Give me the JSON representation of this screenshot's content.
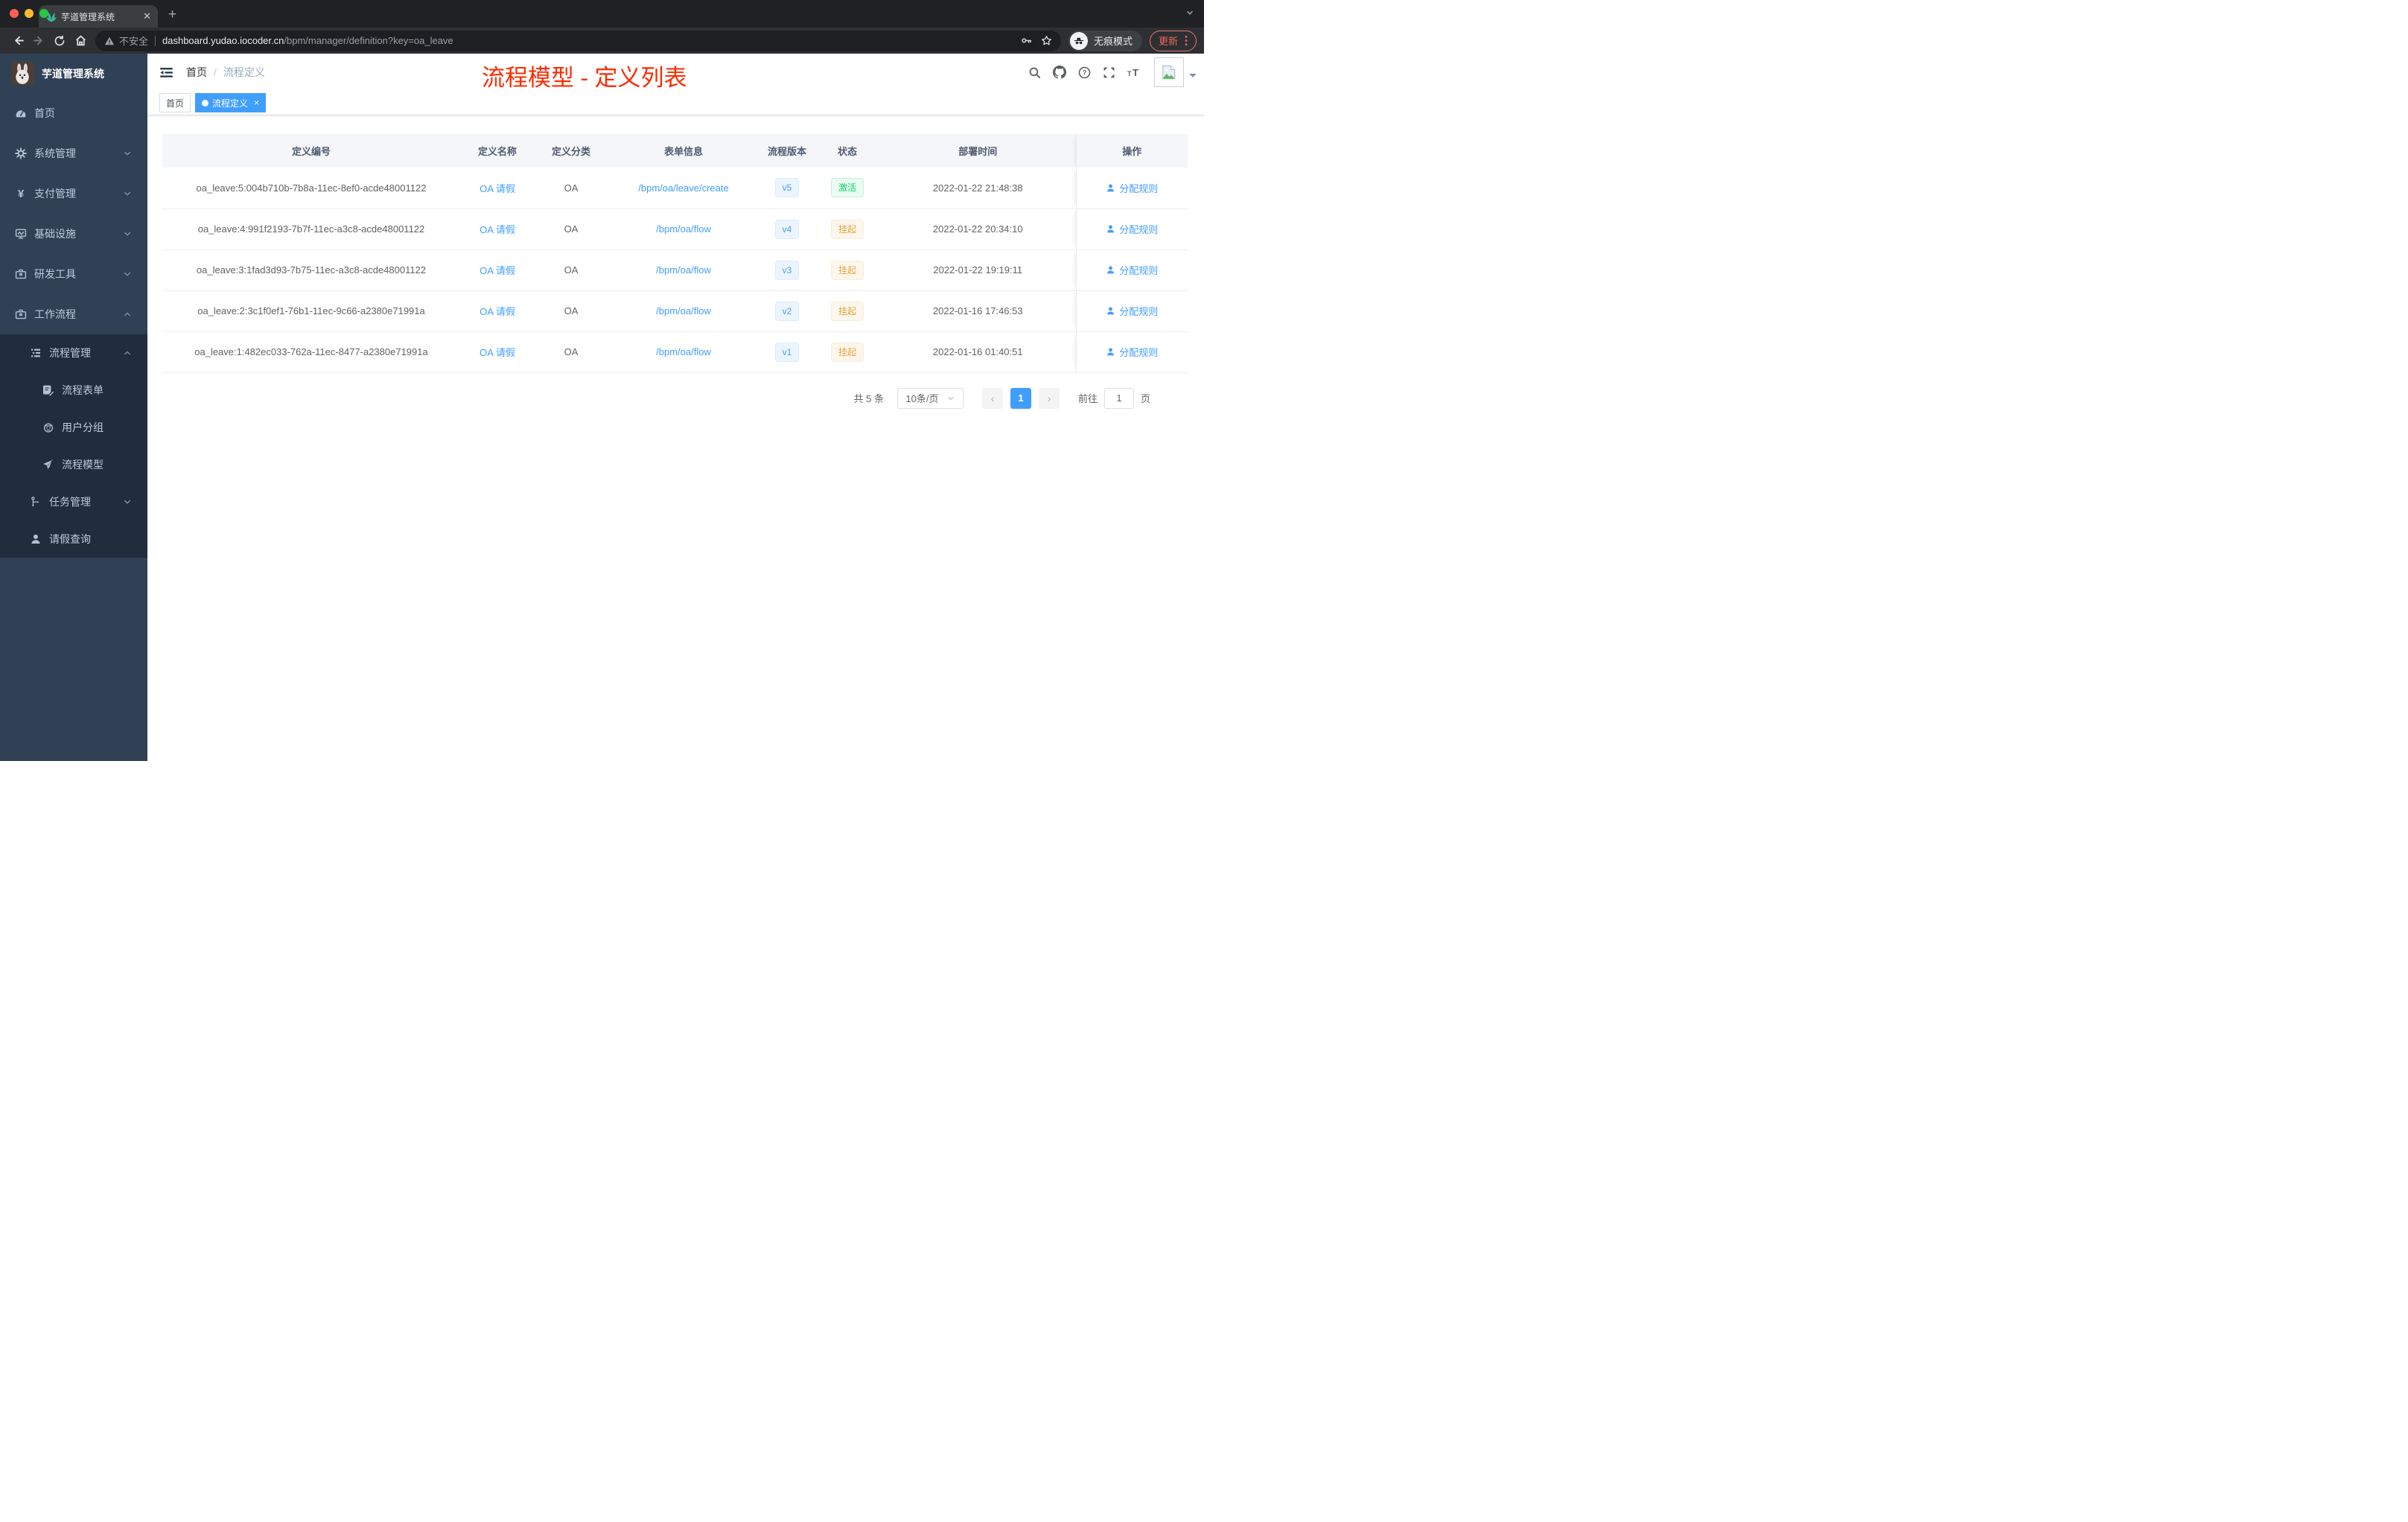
{
  "browser": {
    "tab_title": "芋道管理系统",
    "security_warning": "不安全",
    "url_host": "dashboard.yudao.iocoder.cn",
    "url_path": "/bpm/manager/definition?key=oa_leave",
    "incognito_label": "无痕模式",
    "update_label": "更新"
  },
  "sidebar": {
    "logo_title": "芋道管理系统",
    "items": [
      {
        "label": "首页",
        "icon": "dashboard-icon",
        "level": 1
      },
      {
        "label": "系统管理",
        "icon": "gear-icon",
        "level": 1,
        "arrow": "down"
      },
      {
        "label": "支付管理",
        "icon": "yen-icon",
        "level": 1,
        "arrow": "down"
      },
      {
        "label": "基础设施",
        "icon": "monitor-icon",
        "level": 1,
        "arrow": "down"
      },
      {
        "label": "研发工具",
        "icon": "toolbox-icon",
        "level": 1,
        "arrow": "down"
      },
      {
        "label": "工作流程",
        "icon": "briefcase-icon",
        "level": 1,
        "arrow": "up"
      },
      {
        "label": "流程管理",
        "icon": "list-icon",
        "level": 2,
        "arrow": "up",
        "dark": true
      },
      {
        "label": "流程表单",
        "icon": "form-icon",
        "level": 3,
        "dark": true
      },
      {
        "label": "用户分组",
        "icon": "robot-icon",
        "level": 3,
        "dark": true
      },
      {
        "label": "流程模型",
        "icon": "send-icon",
        "level": 3,
        "dark": true
      },
      {
        "label": "任务管理",
        "icon": "tree-icon",
        "level": 2,
        "arrow": "down",
        "dark": true
      },
      {
        "label": "请假查询",
        "icon": "user-icon",
        "level": 2,
        "dark": true
      }
    ]
  },
  "header": {
    "breadcrumb_home": "首页",
    "breadcrumb_separator": "/",
    "breadcrumb_current": "流程定义"
  },
  "overlay_title": {
    "text": "流程模型 - 定义列表",
    "color": "#fd2b00"
  },
  "tags": [
    {
      "label": "首页",
      "active": false,
      "closable": false
    },
    {
      "label": "流程定义",
      "active": true,
      "closable": true
    }
  ],
  "table": {
    "columns": [
      "定义编号",
      "定义名称",
      "定义分类",
      "表单信息",
      "流程版本",
      "状态",
      "部署时间",
      "操作"
    ],
    "rows": [
      {
        "id": "oa_leave:5:004b710b-7b8a-11ec-8ef0-acde48001122",
        "name": "OA 请假",
        "category": "OA",
        "form": "/bpm/oa/leave/create",
        "version": "v5",
        "status": "激活",
        "status_type": "success",
        "time": "2022-01-22 21:48:38",
        "action": "分配规则"
      },
      {
        "id": "oa_leave:4:991f2193-7b7f-11ec-a3c8-acde48001122",
        "name": "OA 请假",
        "category": "OA",
        "form": "/bpm/oa/flow",
        "version": "v4",
        "status": "挂起",
        "status_type": "warning",
        "time": "2022-01-22 20:34:10",
        "action": "分配规则"
      },
      {
        "id": "oa_leave:3:1fad3d93-7b75-11ec-a3c8-acde48001122",
        "name": "OA 请假",
        "category": "OA",
        "form": "/bpm/oa/flow",
        "version": "v3",
        "status": "挂起",
        "status_type": "warning",
        "time": "2022-01-22 19:19:11",
        "action": "分配规则"
      },
      {
        "id": "oa_leave:2:3c1f0ef1-76b1-11ec-9c66-a2380e71991a",
        "name": "OA 请假",
        "category": "OA",
        "form": "/bpm/oa/flow",
        "version": "v2",
        "status": "挂起",
        "status_type": "warning",
        "time": "2022-01-16 17:46:53",
        "action": "分配规则"
      },
      {
        "id": "oa_leave:1:482ec033-762a-11ec-8477-a2380e71991a",
        "name": "OA 请假",
        "category": "OA",
        "form": "/bpm/oa/flow",
        "version": "v1",
        "status": "挂起",
        "status_type": "warning",
        "time": "2022-01-16 01:40:51",
        "action": "分配规则"
      }
    ]
  },
  "pagination": {
    "total": "共 5 条",
    "page_size": "10条/页",
    "current_page": "1",
    "goto_label": "前往",
    "goto_value": "1",
    "goto_suffix": "页"
  },
  "colors": {
    "accent": "#409eff",
    "title_red": "#fd2b00",
    "success_text": "#13ce66",
    "warning_text": "#e6a23c",
    "sidebar_bg": "#304156",
    "sidebar_submenu_bg": "#1f2d3d"
  }
}
